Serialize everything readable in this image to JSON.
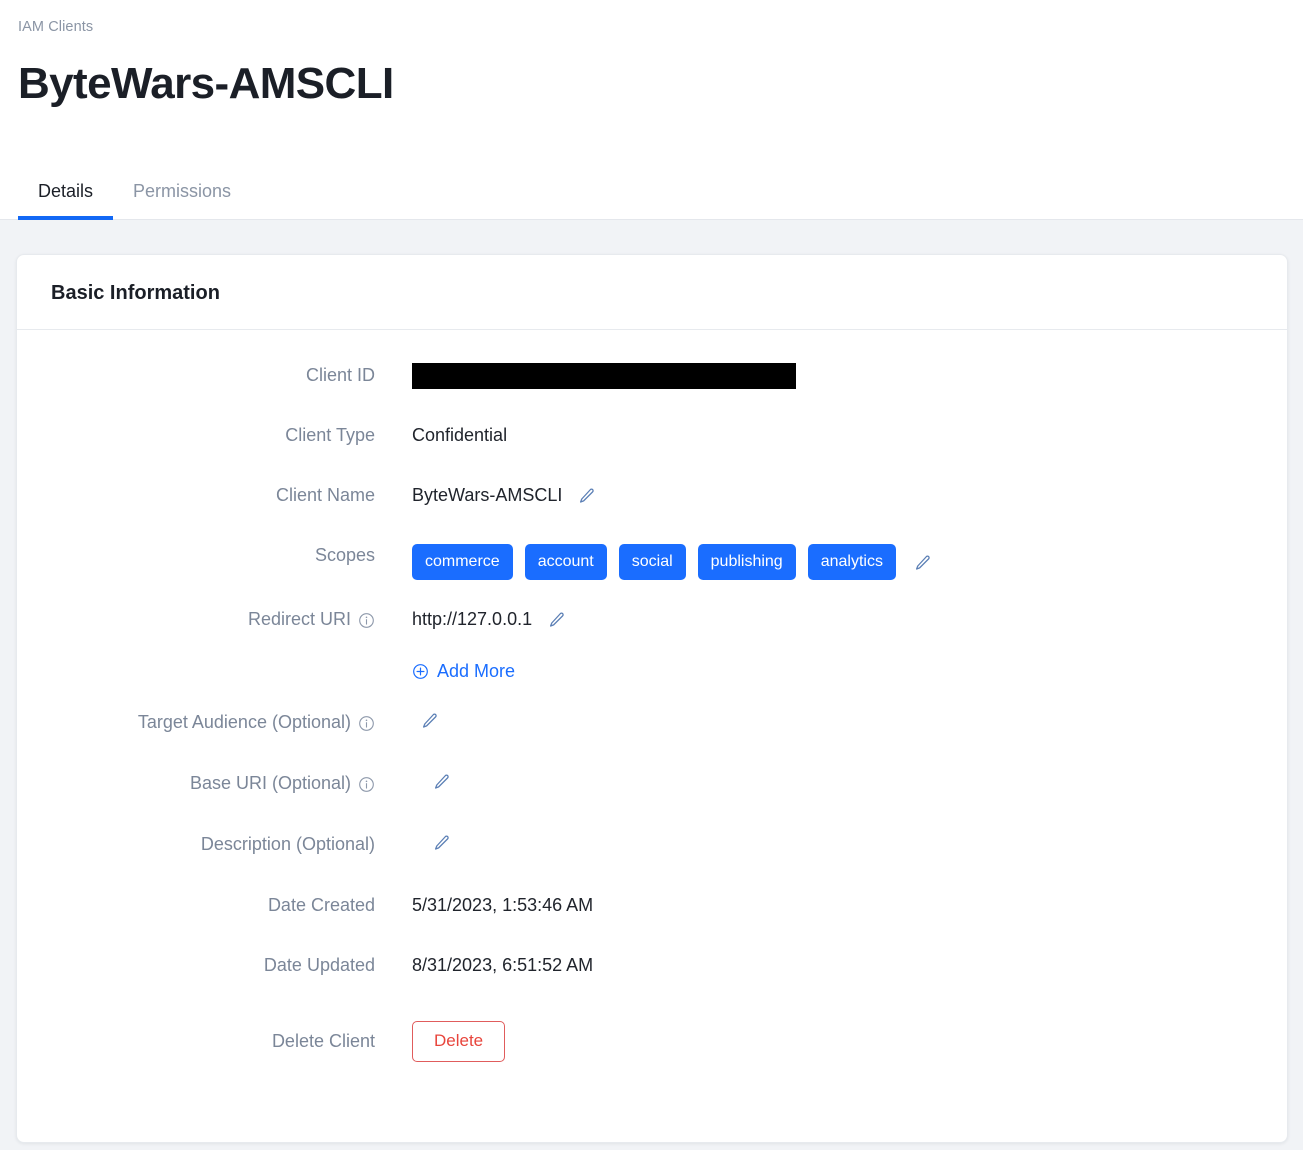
{
  "breadcrumb": "IAM Clients",
  "page_title": "ByteWars-AMSCLI",
  "tabs": [
    {
      "label": "Details",
      "active": true
    },
    {
      "label": "Permissions",
      "active": false
    }
  ],
  "card": {
    "title": "Basic Information"
  },
  "fields": {
    "client_id": {
      "label": "Client ID",
      "value": "",
      "redacted": true
    },
    "client_type": {
      "label": "Client Type",
      "value": "Confidential"
    },
    "client_name": {
      "label": "Client Name",
      "value": "ByteWars-AMSCLI",
      "edit_icon": "pencil-icon"
    },
    "scopes": {
      "label": "Scopes",
      "values": [
        "commerce",
        "account",
        "social",
        "publishing",
        "analytics"
      ],
      "edit_icon": "pencil-icon"
    },
    "redirect_uri": {
      "label": "Redirect URI",
      "info_icon": "info-icon",
      "value": "http://127.0.0.1",
      "edit_icon": "pencil-icon",
      "add_more_label": "Add More"
    },
    "target_audience": {
      "label": "Target Audience (Optional)",
      "info_icon": "info-icon",
      "value": "",
      "edit_icon": "pencil-icon"
    },
    "base_uri": {
      "label": "Base URI (Optional)",
      "info_icon": "info-icon",
      "value": "",
      "edit_icon": "pencil-icon"
    },
    "description": {
      "label": "Description (Optional)",
      "value": "",
      "edit_icon": "pencil-icon"
    },
    "date_created": {
      "label": "Date Created",
      "value": "5/31/2023, 1:53:46 AM"
    },
    "date_updated": {
      "label": "Date Updated",
      "value": "8/31/2023, 6:51:52 AM"
    },
    "delete_client": {
      "label": "Delete Client",
      "button_label": "Delete"
    }
  },
  "colors": {
    "accent_blue": "#1a6dff",
    "tab_underline": "#1268f5",
    "danger_red": "#e8453c",
    "page_bg": "#f1f3f6",
    "label_gray": "#7b8698"
  }
}
